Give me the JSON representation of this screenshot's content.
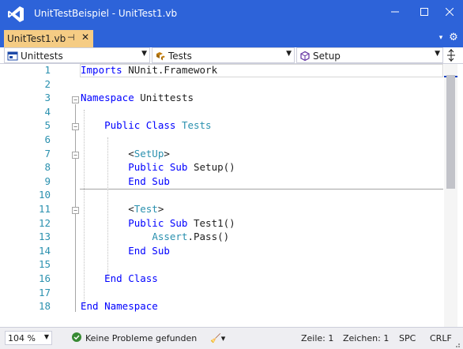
{
  "window": {
    "title": "UnitTestBeispiel - UnitTest1.vb",
    "accent": "#2d63d9"
  },
  "tab": {
    "label": "UnitTest1.vb",
    "pin_icon": "pin-icon",
    "close_icon": "close-icon",
    "accent": "#f5cc84"
  },
  "navbar": {
    "project": "Unittests",
    "type": "Tests",
    "member": "Setup"
  },
  "editor": {
    "line_numbers": [
      "1",
      "2",
      "3",
      "4",
      "5",
      "6",
      "7",
      "8",
      "9",
      "10",
      "11",
      "12",
      "13",
      "14",
      "15",
      "16",
      "17",
      "18"
    ],
    "lines": [
      [
        {
          "t": "Imports",
          "c": "kw"
        },
        {
          "t": " NUnit.Framework",
          "c": "pl"
        }
      ],
      [],
      [
        {
          "t": "Namespace",
          "c": "kw"
        },
        {
          "t": " Unittests",
          "c": "pl"
        }
      ],
      [],
      [
        {
          "t": "    Public Class",
          "c": "kw"
        },
        {
          "t": " ",
          "c": "pl"
        },
        {
          "t": "Tests",
          "c": "ty"
        }
      ],
      [],
      [
        {
          "t": "        <",
          "c": "pl"
        },
        {
          "t": "SetUp",
          "c": "ty"
        },
        {
          "t": ">",
          "c": "pl"
        }
      ],
      [
        {
          "t": "        Public Sub",
          "c": "kw"
        },
        {
          "t": " Setup()",
          "c": "pl"
        }
      ],
      [
        {
          "t": "        End Sub",
          "c": "kw"
        }
      ],
      [],
      [
        {
          "t": "        <",
          "c": "pl"
        },
        {
          "t": "Test",
          "c": "ty"
        },
        {
          "t": ">",
          "c": "pl"
        }
      ],
      [
        {
          "t": "        Public Sub",
          "c": "kw"
        },
        {
          "t": " Test1()",
          "c": "pl"
        }
      ],
      [
        {
          "t": "            ",
          "c": "pl"
        },
        {
          "t": "Assert",
          "c": "ty"
        },
        {
          "t": ".Pass()",
          "c": "pl"
        }
      ],
      [
        {
          "t": "        End Sub",
          "c": "kw"
        }
      ],
      [],
      [
        {
          "t": "    End Class",
          "c": "kw"
        }
      ],
      [],
      [
        {
          "t": "End Namespace",
          "c": "kw"
        }
      ]
    ]
  },
  "statusbar": {
    "zoom": "104 %",
    "problems": "Keine Probleme gefunden",
    "line": "Zeile: 1",
    "char": "Zeichen: 1",
    "spc": "SPC",
    "eol": "CRLF"
  }
}
